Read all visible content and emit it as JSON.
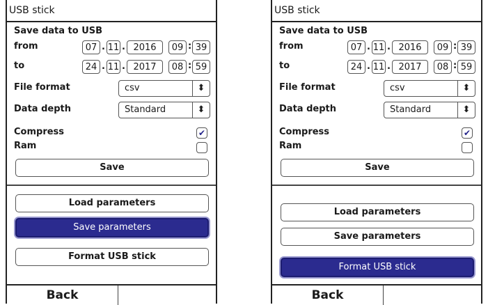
{
  "screens": [
    {
      "title": "USB stick",
      "section_title": "Save data to USB",
      "from_label": "from",
      "to_label": "to",
      "from": {
        "day": "07",
        "month": "11",
        "year": "2016",
        "hour": "09",
        "minute": "39"
      },
      "to": {
        "day": "24",
        "month": "11",
        "year": "2017",
        "hour": "08",
        "minute": "59"
      },
      "date_sep": ".",
      "time_sep": ":",
      "file_format_label": "File format",
      "file_format_value": "csv",
      "data_depth_label": "Data depth",
      "data_depth_value": "Standard",
      "compress_label": "Compress",
      "compress_checked": true,
      "ram_label": "Ram",
      "ram_checked": false,
      "save_label": "Save",
      "load_params_label": "Load parameters",
      "save_params_label": "Save parameters",
      "format_usb_label": "Format USB stick",
      "selected_button": "save_params",
      "back_label": "Back"
    },
    {
      "title": "USB stick",
      "section_title": "Save data to USB",
      "from_label": "from",
      "to_label": "to",
      "from": {
        "day": "07",
        "month": "11",
        "year": "2016",
        "hour": "09",
        "minute": "39"
      },
      "to": {
        "day": "24",
        "month": "11",
        "year": "2017",
        "hour": "08",
        "minute": "59"
      },
      "date_sep": ".",
      "time_sep": ":",
      "file_format_label": "File format",
      "file_format_value": "csv",
      "data_depth_label": "Data depth",
      "data_depth_value": "Standard",
      "compress_label": "Compress",
      "compress_checked": true,
      "ram_label": "Ram",
      "ram_checked": false,
      "save_label": "Save",
      "load_params_label": "Load parameters",
      "save_params_label": "Save parameters",
      "format_usb_label": "Format USB stick",
      "selected_button": "format_usb",
      "back_label": "Back"
    }
  ],
  "icons": {
    "select_arrow": "up-down-arrows-icon",
    "check": "checkmark-icon"
  },
  "colors": {
    "selected_button_bg": "#2b2b8f",
    "selected_button_text": "#ffffff"
  }
}
